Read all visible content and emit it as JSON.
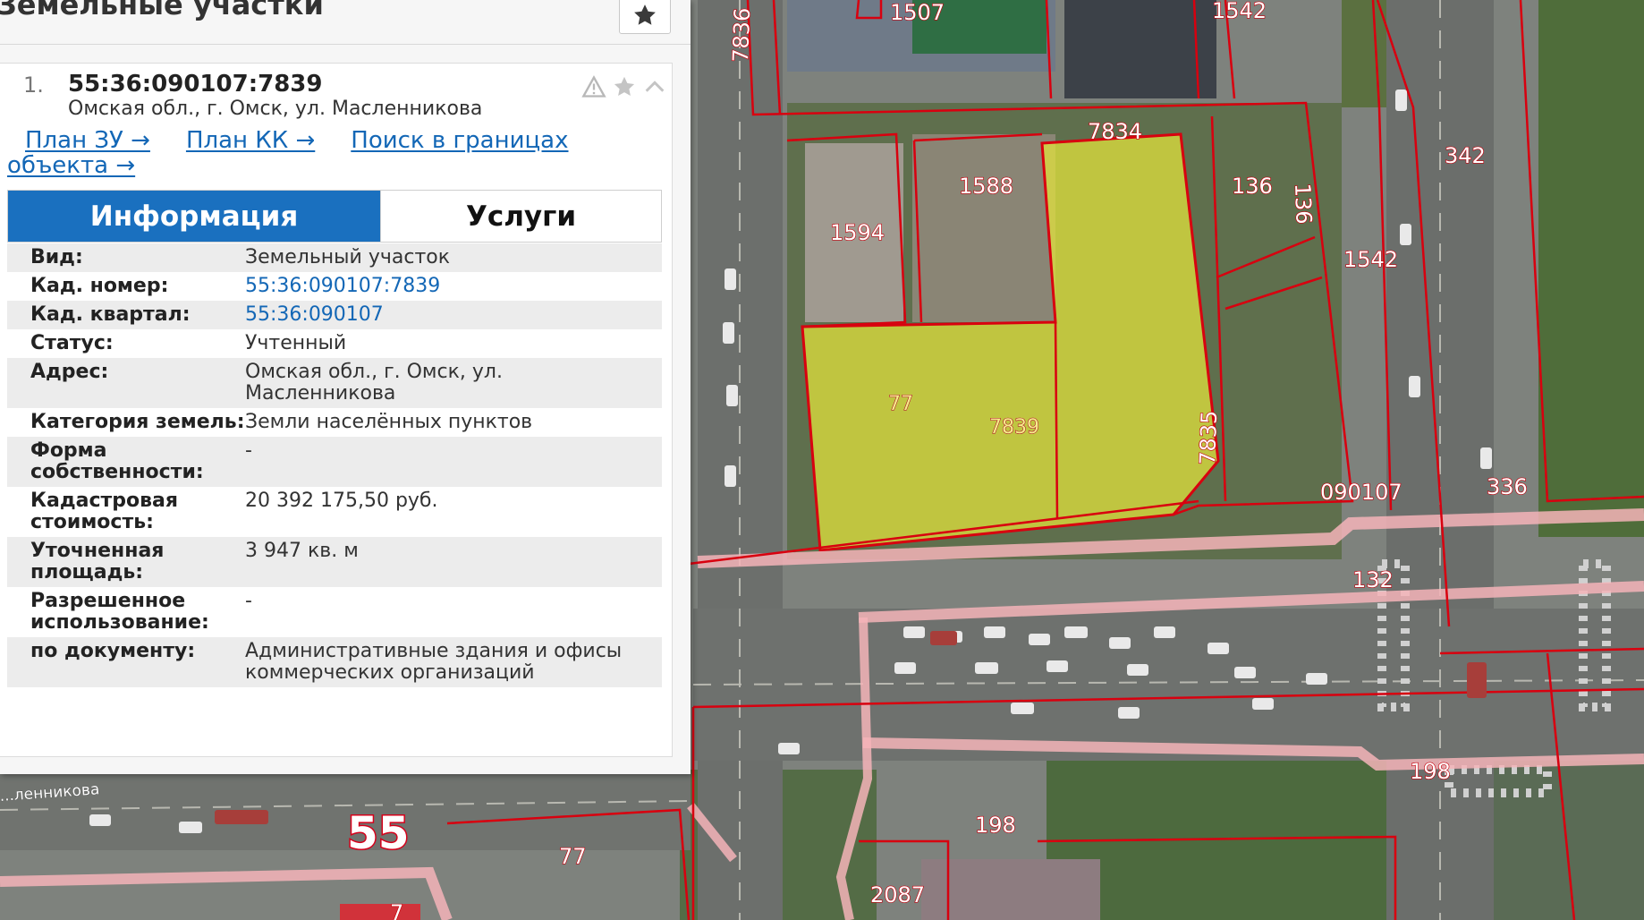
{
  "panel": {
    "title": "Земельные участки",
    "favorite_icon": "star-icon"
  },
  "result": {
    "number": "1.",
    "cadastral_number": "55:36:090107:7839",
    "address": "Омская обл., г. Омск, ул. Масленникова",
    "icons": [
      "warning-icon",
      "star-icon",
      "chevron-up-icon"
    ],
    "links": {
      "plan_zu": "План ЗУ →",
      "plan_kk": "План КК →",
      "search_line1": "Поиск в границах",
      "search_line2": "объекта →"
    }
  },
  "tabs": {
    "info": "Информация",
    "services": "Услуги"
  },
  "info_rows": [
    {
      "key": "Вид:",
      "value": "Земельный участок",
      "is_link": false
    },
    {
      "key": "Кад. номер:",
      "value": "55:36:090107:7839",
      "is_link": true
    },
    {
      "key": "Кад. квартал:",
      "value": "55:36:090107",
      "is_link": true
    },
    {
      "key": "Статус:",
      "value": "Учтенный",
      "is_link": false
    },
    {
      "key": "Адрес:",
      "value": "Омская обл., г. Омск, ул. Масленникова",
      "is_link": false
    },
    {
      "key": "Категория земель:",
      "value": "Земли населённых пунктов",
      "is_link": false
    },
    {
      "key": "Форма собственности:",
      "value": "-",
      "is_link": false
    },
    {
      "key": "Кадастровая стоимость:",
      "value": "20 392 175,50 руб.",
      "is_link": false
    },
    {
      "key": "Уточненная площадь:",
      "value": "3 947 кв. м",
      "is_link": false
    },
    {
      "key": "Разрешенное использование:",
      "value": "-",
      "is_link": false
    },
    {
      "key": "по документу:",
      "value": "Административные здания и офисы коммерческих организаций",
      "is_link": false
    }
  ],
  "map": {
    "parcel_labels": [
      "1507",
      "7836",
      "1542",
      "7834",
      "1588",
      "1594",
      "136",
      "136",
      "342",
      "1542",
      "77",
      "7839",
      "7835",
      "090107",
      "336",
      "132",
      "198",
      "198",
      "2087",
      "77",
      "55",
      "7"
    ],
    "street_label": "...ленникова",
    "selected_color": "#e6e63c",
    "boundary_color": "#d8000f"
  }
}
